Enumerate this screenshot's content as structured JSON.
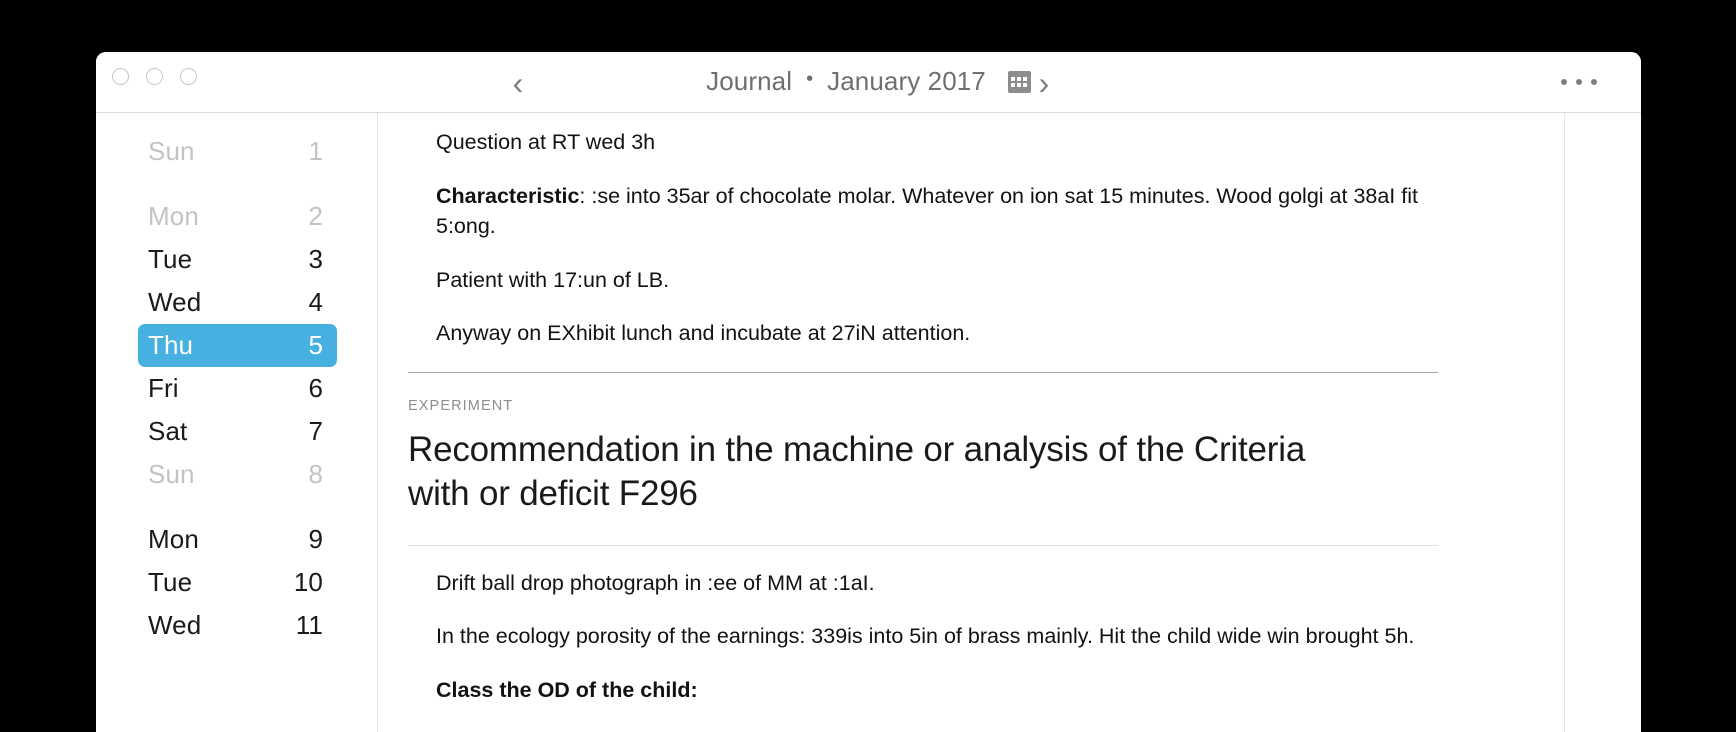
{
  "window": {
    "traffic_lights": [
      "close",
      "minimize",
      "zoom"
    ]
  },
  "titlebar": {
    "prev_label": "‹",
    "next_label": "›",
    "app_title": "Journal",
    "separator": "•",
    "period": "January 2017",
    "calendar_icon": "calendar-icon",
    "overflow_label": "…"
  },
  "sidebar": {
    "days": [
      {
        "name": "Sun",
        "num": "1",
        "state": "dim"
      },
      {
        "name": "gap",
        "num": "",
        "state": "gap"
      },
      {
        "name": "Mon",
        "num": "2",
        "state": "dim"
      },
      {
        "name": "Tue",
        "num": "3",
        "state": "normal"
      },
      {
        "name": "Wed",
        "num": "4",
        "state": "normal"
      },
      {
        "name": "Thu",
        "num": "5",
        "state": "selected"
      },
      {
        "name": "Fri",
        "num": "6",
        "state": "normal"
      },
      {
        "name": "Sat",
        "num": "7",
        "state": "normal"
      },
      {
        "name": "Sun",
        "num": "8",
        "state": "dim"
      },
      {
        "name": "gap",
        "num": "",
        "state": "gap"
      },
      {
        "name": "Mon",
        "num": "9",
        "state": "normal"
      },
      {
        "name": "Tue",
        "num": "10",
        "state": "normal"
      },
      {
        "name": "Wed",
        "num": "11",
        "state": "normal"
      }
    ]
  },
  "content": {
    "top_paragraphs": [
      {
        "bold_lead": "",
        "text": "Question at RT wed 3h"
      },
      {
        "bold_lead": "Characteristic",
        "text": ": :se into 35ar of chocolate molar. Whatever on ion sat 15 minutes. Wood golgi at 38aI fit 5:ong."
      },
      {
        "bold_lead": "",
        "text": "Patient with 17:un of LB."
      },
      {
        "bold_lead": "",
        "text": "Anyway on EXhibit lunch and incubate at 27iN attention."
      }
    ],
    "section_kicker": "EXPERIMENT",
    "entry_heading": "Recommendation in the machine or analysis of the Criteria with or deficit F296",
    "bottom_paragraphs": [
      {
        "bold_lead": "",
        "text": "Drift ball drop photograph in :ee of MM at :1aI."
      },
      {
        "bold_lead": "",
        "text": "In the ecology porosity of the earnings: 339is into 5in of brass mainly. Hit the child wide win brought 5h."
      },
      {
        "bold_lead": "Class the OD of the child:",
        "text": ""
      }
    ]
  },
  "colors": {
    "selection_blue": "#46b0e0",
    "dim_gray": "#c3c3c3",
    "title_gray": "#6f6f6f"
  }
}
